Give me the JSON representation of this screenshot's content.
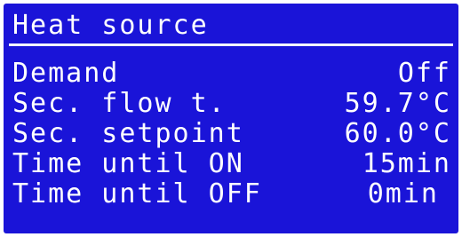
{
  "screen": {
    "title": "Heat source",
    "rows": [
      {
        "label": "Demand",
        "value": "Off"
      },
      {
        "label": "Sec. flow t.",
        "value": "59.7°C"
      },
      {
        "label": "Sec. setpoint",
        "value": "60.0°C"
      },
      {
        "label": "Time until ON",
        "value": "15min"
      },
      {
        "label": "Time until OFF",
        "value": "0min"
      }
    ]
  },
  "colors": {
    "screen_background": "#1a14d8",
    "text": "#ffffff"
  }
}
